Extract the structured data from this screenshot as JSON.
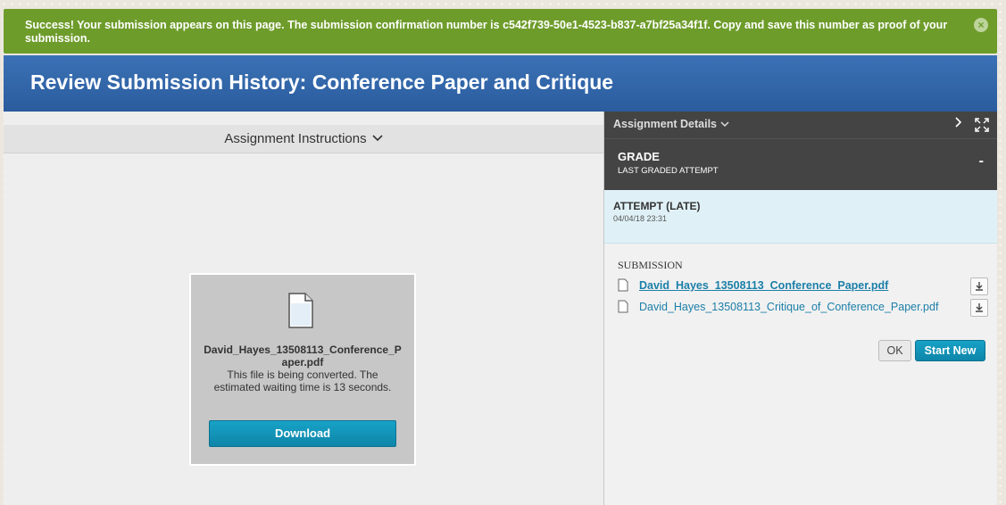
{
  "banner": {
    "message": "Success! Your submission appears on this page. The submission confirmation number is c542f739-50e1-4523-b837-a7bf25a34f1f. Copy and save this number as proof of your submission.",
    "close_icon": "close-circle-icon",
    "color": "#6e9c2b"
  },
  "header": {
    "title": "Review Submission History: Conference Paper and Critique",
    "color": "#2f65a9"
  },
  "instructions": {
    "label": "Assignment Instructions",
    "chevron_icon": "chevron-down-icon"
  },
  "preview": {
    "filename": "David_Hayes_13508113_Conference_Paper.pdf",
    "message": "This file is being converted. The estimated waiting time is 13 seconds.",
    "download_label": "Download"
  },
  "details": {
    "label": "Assignment Details",
    "grade_title": "GRADE",
    "grade_subtitle": "LAST GRADED ATTEMPT",
    "grade_value": "-",
    "attempt_title": "ATTEMPT (LATE)",
    "attempt_date": "04/04/18 23:31",
    "submission_label": "SUBMISSION",
    "files": [
      {
        "name": "David_Hayes_13508113_Conference_Paper.pdf",
        "active": true
      },
      {
        "name": "David_Hayes_13508113_Critique_of_Conference_Paper.pdf",
        "active": false
      }
    ],
    "ok_label": "OK",
    "start_new_label": "Start New"
  }
}
